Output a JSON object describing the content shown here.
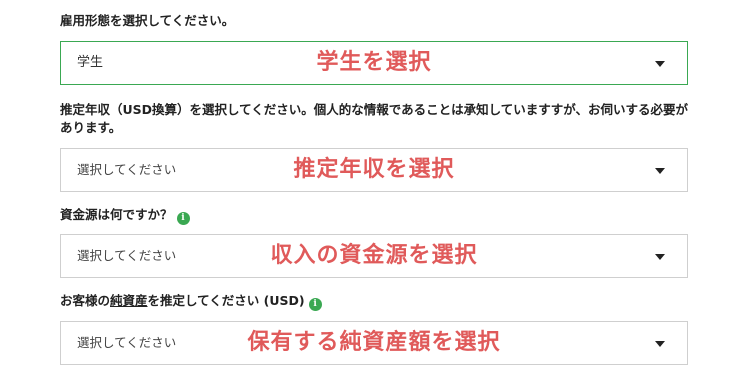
{
  "questions": [
    {
      "label": "雇用形態を選択してください。",
      "value": "学生",
      "annotation": "学生を選択"
    },
    {
      "label": "推定年収（USD換算）を選択してください。個人的な情報であることは承知していますすが、お伺いする必要があります。",
      "value": "選択してください",
      "annotation": "推定年収を選択"
    },
    {
      "label": "資金源は何ですか？",
      "value": "選択してください",
      "annotation": "収入の資金源を選択"
    },
    {
      "label_prefix": "お客様の",
      "label_underlined": "純資産",
      "label_suffix": "を推定してください (USD)",
      "value": "選択してください",
      "annotation": "保有する純資産額を選択"
    }
  ],
  "info_glyph": "i",
  "colors": {
    "accent": "#3aa852",
    "annotation": "#e05a5a"
  }
}
